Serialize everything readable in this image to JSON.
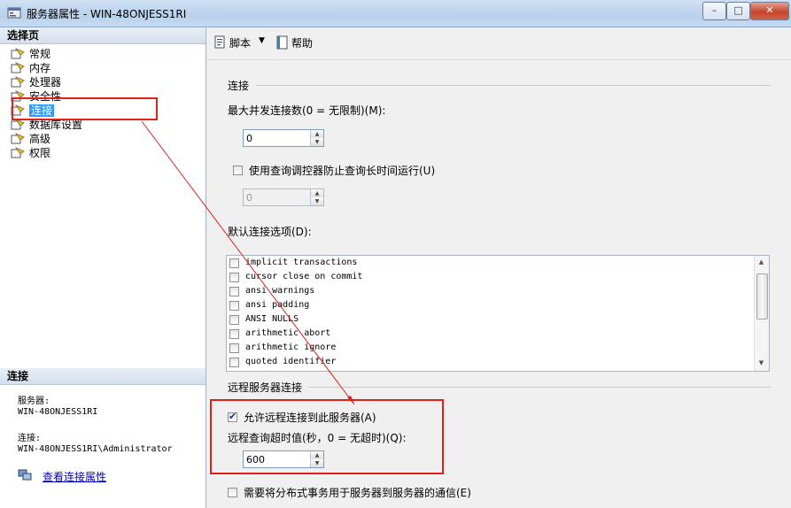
{
  "window": {
    "title": "服务器属性 - WIN-48ONJESS1RI",
    "min_label": "–",
    "max_label": "□",
    "close_label": "✕"
  },
  "left": {
    "select_page_header": "选择页",
    "items": [
      {
        "label": "常规"
      },
      {
        "label": "内存"
      },
      {
        "label": "处理器"
      },
      {
        "label": "安全性"
      },
      {
        "label": "连接"
      },
      {
        "label": "数据库设置"
      },
      {
        "label": "高级"
      },
      {
        "label": "权限"
      }
    ],
    "connection_header": "连接",
    "server_label": "服务器:",
    "server_value": "WIN-48ONJESS1RI",
    "conn_label": "连接:",
    "conn_value": "WIN-48ONJESS1RI\\Administrator",
    "view_link": "查看连接属性"
  },
  "toolbar": {
    "script_label": "脚本",
    "help_label": "帮助"
  },
  "main": {
    "section_connection": "连接",
    "max_conn_label": "最大并发连接数(0 = 无限制)(M):",
    "max_conn_value": "0",
    "use_governor_label": "使用查询调控器防止查询长时间运行(U)",
    "governor_value": "0",
    "default_options_label": "默认连接选项(D):",
    "options": [
      {
        "label": "implicit transactions",
        "checked": false
      },
      {
        "label": "cursor close on commit",
        "checked": false
      },
      {
        "label": "ansi warnings",
        "checked": false
      },
      {
        "label": "ansi padding",
        "checked": false
      },
      {
        "label": "ANSI NULLS",
        "checked": false
      },
      {
        "label": "arithmetic abort",
        "checked": false
      },
      {
        "label": "arithmetic ignore",
        "checked": false
      },
      {
        "label": "quoted identifier",
        "checked": false
      }
    ],
    "section_remote": "远程服务器连接",
    "allow_remote_label": "允许远程连接到此服务器(A)",
    "allow_remote_checked": true,
    "remote_timeout_label": "远程查询超时值(秒，0 = 无超时)(Q):",
    "remote_timeout_value": "600",
    "distributed_label": "需要将分布式事务用于服务器到服务器的通信(E)"
  },
  "colors": {
    "highlight": "#3399ff",
    "annotation_red": "#e0201b"
  }
}
